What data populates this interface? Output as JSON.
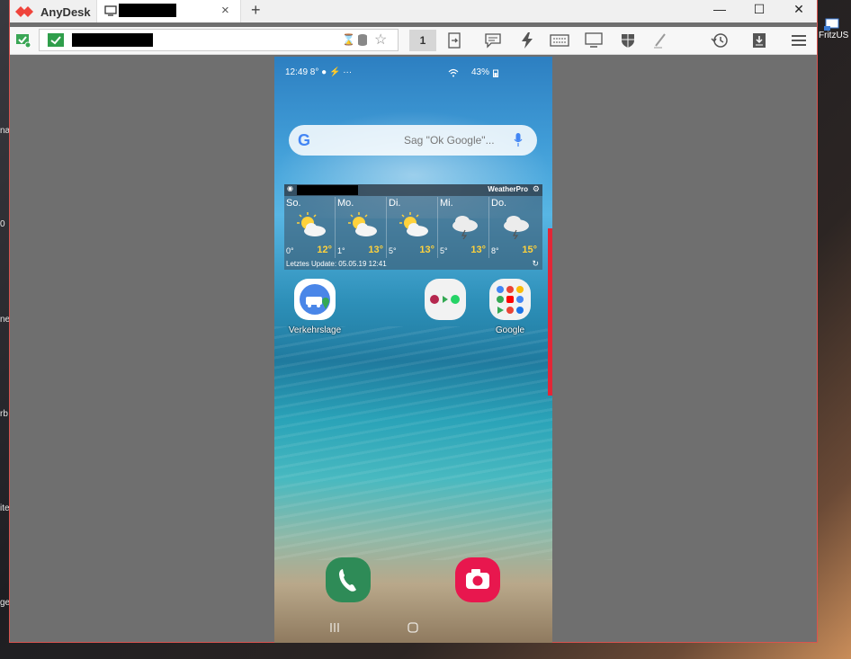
{
  "desktop": {
    "side_labels": [
      "nac",
      "0",
      "ne",
      "rb",
      "ite",
      "ge"
    ],
    "fritz_icon_label": "FritzUS"
  },
  "window": {
    "app_name": "AnyDesk",
    "new_tab": "+",
    "controls": {
      "minimize": "—",
      "maximize": "☐",
      "close": "✕"
    },
    "monitor_number": "1"
  },
  "phone": {
    "status": {
      "left": "12:49  8°  ●  ⚡  ···",
      "right": "43%"
    },
    "search_placeholder": "Sag \"Ok Google\"...",
    "weather": {
      "brand": "WeatherPro",
      "days": [
        {
          "name": "So.",
          "low": "0°",
          "high": "12°",
          "icon": "sun-cloud"
        },
        {
          "name": "Mo.",
          "low": "1°",
          "high": "13°",
          "icon": "sun-cloud"
        },
        {
          "name": "Di.",
          "low": "5°",
          "high": "13°",
          "icon": "sun-cloud"
        },
        {
          "name": "Mi.",
          "low": "5°",
          "high": "13°",
          "icon": "cloud-storm"
        },
        {
          "name": "Do.",
          "low": "8°",
          "high": "15°",
          "icon": "cloud-storm"
        }
      ],
      "update_text": "Letztes Update: 05.05.19 12:41"
    },
    "apps": [
      {
        "label": "Verkehrslage"
      },
      {
        "label": ""
      },
      {
        "label": "Google"
      }
    ],
    "accent_colors": {
      "phone": "#2e8b57",
      "camera": "#e8174e"
    }
  }
}
